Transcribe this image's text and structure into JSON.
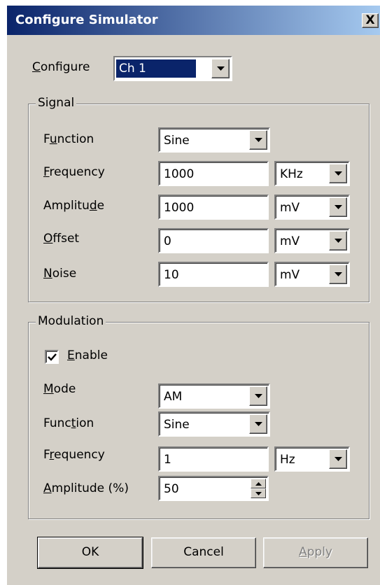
{
  "window": {
    "title": "Configure Simulator",
    "close_label": "X"
  },
  "configure": {
    "label_prefix": "",
    "label_ul": "C",
    "label_rest": "onfigure",
    "value": "Ch 1"
  },
  "signal": {
    "legend": "Signal",
    "function": {
      "label_pre": "F",
      "label_ul": "u",
      "label_post": "nction",
      "value": "Sine"
    },
    "frequency": {
      "label_pre": "",
      "label_ul": "F",
      "label_post": "requency",
      "value": "1000",
      "unit": "KHz"
    },
    "amplitude": {
      "label_pre": "Amplitu",
      "label_ul": "d",
      "label_post": "e",
      "value": "1000",
      "unit": "mV"
    },
    "offset": {
      "label_pre": "",
      "label_ul": "O",
      "label_post": "ffset",
      "value": "0",
      "unit": "mV"
    },
    "noise": {
      "label_pre": "",
      "label_ul": "N",
      "label_post": "oise",
      "value": "10",
      "unit": "mV"
    }
  },
  "modulation": {
    "legend": "Modulation",
    "enable": {
      "label_pre": "",
      "label_ul": "E",
      "label_post": "nable",
      "checked": true
    },
    "mode": {
      "label_pre": "",
      "label_ul": "M",
      "label_post": "ode",
      "value": "AM"
    },
    "function": {
      "label_pre": "Func",
      "label_ul": "t",
      "label_post": "ion",
      "value": "Sine"
    },
    "frequency": {
      "label_pre": "F",
      "label_ul": "r",
      "label_post": "equency",
      "value": "1",
      "unit": "Hz"
    },
    "amplitude": {
      "label_pre": "",
      "label_ul": "A",
      "label_post": "mplitude (%)",
      "value": "50"
    }
  },
  "buttons": {
    "ok": "OK",
    "cancel": "Cancel",
    "apply_ul": "A",
    "apply_rest": "pply"
  }
}
